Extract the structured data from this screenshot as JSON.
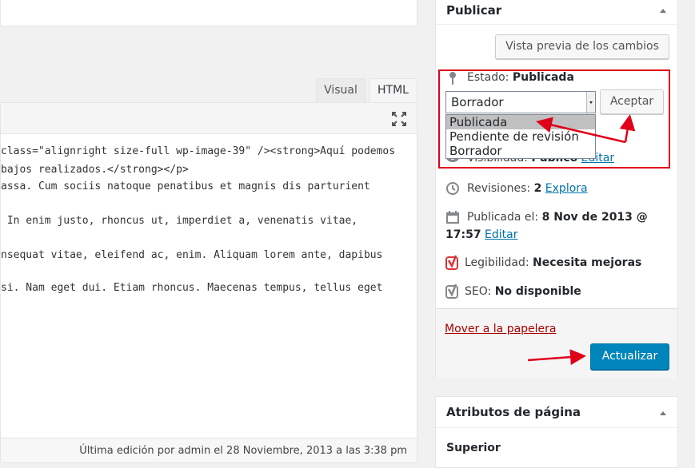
{
  "editor": {
    "tabs": [
      {
        "label": "Visual"
      },
      {
        "label": "HTML"
      }
    ],
    "code_lines": [
      "class=\"alignright size-full wp-image-39\" /><strong>Aquí podemos",
      "bajos realizados.</strong></p>",
      "assa. Cum sociis natoque penatibus et magnis dis parturient",
      "",
      " In enim justo, rhoncus ut, imperdiet a, venenatis vitae,",
      "",
      "nsequat vitae, eleifend ac, enim. Aliquam lorem ante, dapibus",
      "si. Nam eget dui. Etiam rhoncus. Maecenas tempus, tellus eget"
    ],
    "status": "Última edición por admin el 28 Noviembre, 2013 a las 3:38 pm"
  },
  "publish": {
    "title": "Publicar",
    "preview_button": "Vista previa de los cambios",
    "status_label": "Estado:",
    "status_value": "Publicada",
    "select_value": "Borrador",
    "accept_button": "Aceptar",
    "options": [
      "Publicada",
      "Pendiente de revisión",
      "Borrador"
    ],
    "visibility_label": "Visibilidad:",
    "visibility_value": "Público",
    "visibility_edit": "Editar",
    "revisions_label": "Revisiones:",
    "revisions_value": "2",
    "revisions_link": "Explora",
    "published_label": "Publicada el:",
    "published_date": "8 Nov de 2013 @",
    "published_time": "17:57",
    "published_edit": "Editar",
    "readability_label": "Legibilidad:",
    "readability_value": "Necesita mejoras",
    "seo_label": "SEO:",
    "seo_value": "No disponible",
    "trash_link": "Mover a la papelera",
    "update_button": "Actualizar"
  },
  "attributes": {
    "title": "Atributos de página",
    "parent_label": "Superior"
  },
  "colors": {
    "annotation_red": "#e0001a",
    "primary_blue": "#0085ba",
    "yoast_red": "#dc3232",
    "yoast_gray": "#888888"
  }
}
